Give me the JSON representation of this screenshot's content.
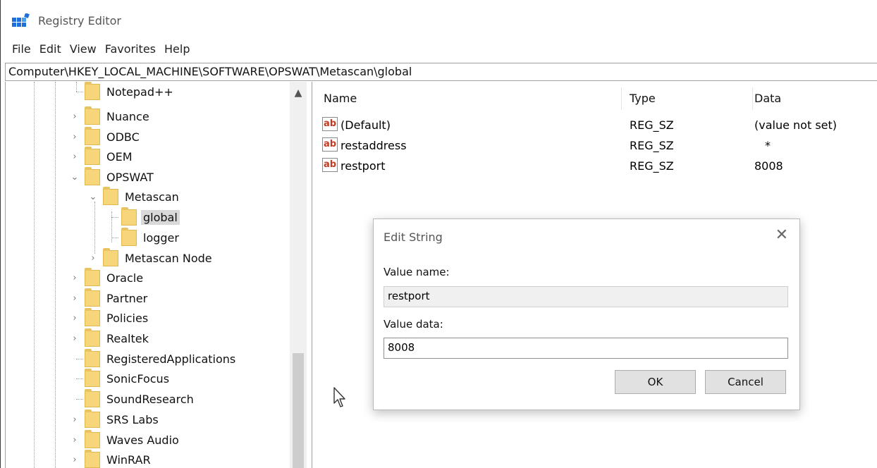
{
  "window": {
    "title": "Registry Editor",
    "icon": "registry-editor-icon"
  },
  "menu": [
    "File",
    "Edit",
    "View",
    "Favorites",
    "Help"
  ],
  "address": "Computer\\HKEY_LOCAL_MACHINE\\SOFTWARE\\OPSWAT\\Metascan\\global",
  "tree": [
    {
      "label": "Notepad++",
      "chevron": "",
      "level": 0
    },
    {
      "label": "Nuance",
      "chevron": ">",
      "level": 0
    },
    {
      "label": "ODBC",
      "chevron": ">",
      "level": 0
    },
    {
      "label": "OEM",
      "chevron": ">",
      "level": 0
    },
    {
      "label": "OPSWAT",
      "chevron": "v",
      "level": 0
    },
    {
      "label": "Metascan",
      "chevron": "v",
      "level": 1
    },
    {
      "label": "global",
      "chevron": "",
      "level": 2,
      "selected": true
    },
    {
      "label": "logger",
      "chevron": "",
      "level": 2
    },
    {
      "label": "Metascan Node",
      "chevron": ">",
      "level": 1
    },
    {
      "label": "Oracle",
      "chevron": ">",
      "level": 0
    },
    {
      "label": "Partner",
      "chevron": ">",
      "level": 0
    },
    {
      "label": "Policies",
      "chevron": ">",
      "level": 0
    },
    {
      "label": "Realtek",
      "chevron": ">",
      "level": 0
    },
    {
      "label": "RegisteredApplications",
      "chevron": "",
      "level": 0
    },
    {
      "label": "SonicFocus",
      "chevron": "",
      "level": 0
    },
    {
      "label": "SoundResearch",
      "chevron": "",
      "level": 0
    },
    {
      "label": "SRS Labs",
      "chevron": ">",
      "level": 0
    },
    {
      "label": "Waves Audio",
      "chevron": ">",
      "level": 0
    },
    {
      "label": "WinRAR",
      "chevron": ">",
      "level": 0
    }
  ],
  "columns": {
    "name": "Name",
    "type": "Type",
    "data": "Data"
  },
  "values": [
    {
      "icon": "ab",
      "name": "(Default)",
      "type": "REG_SZ",
      "data": "(value not set)"
    },
    {
      "icon": "ab",
      "name": "restaddress",
      "type": "REG_SZ",
      "data": "*"
    },
    {
      "icon": "ab",
      "name": "restport",
      "type": "REG_SZ",
      "data": "8008"
    }
  ],
  "dialog": {
    "title": "Edit String",
    "close": "✕",
    "value_name_label": "Value name:",
    "value_name": "restport",
    "value_data_label": "Value data:",
    "value_data": "8008",
    "ok": "OK",
    "cancel": "Cancel"
  },
  "colors": {
    "folder": "#f7d57a",
    "selection": "#d9d9d9",
    "string_icon": "#c23b22"
  }
}
